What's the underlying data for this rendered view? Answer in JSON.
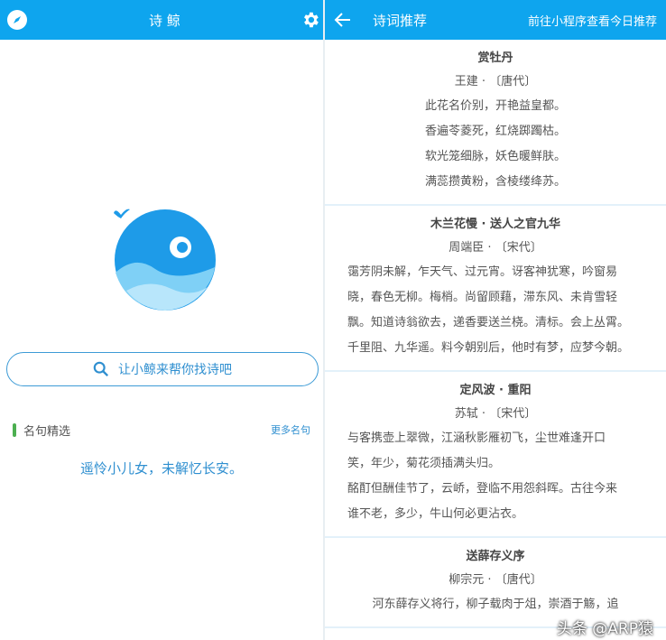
{
  "home": {
    "title": "诗 鲸",
    "search_placeholder": "让小鲸来帮你找诗吧",
    "section_title": "名句精选",
    "more_label": "更多名句",
    "quote": "遥怜小儿女，未解忆长安。"
  },
  "recommend": {
    "title": "诗词推荐",
    "action": "前往小程序查看今日推荐",
    "poems": [
      {
        "title": "赏牡丹",
        "author": "王建 · 〔唐代〕",
        "align": "center",
        "lines": [
          "此花名价别，开艳益皇都。",
          "香遍苓菱死，红烧踯躅枯。",
          "软光笼细脉，妖色暖鲜肤。",
          "满蕊攒黄粉，含棱缕绛苏。"
        ]
      },
      {
        "title": "木兰花慢 · 送人之官九华",
        "author": "周端臣 · 〔宋代〕",
        "align": "left",
        "lines": [
          "霭芳阴未解，乍天气、过元宵。讶客神犹寒，吟窗易",
          "晓，春色无柳。梅梢。尚留顾藉，滞东风、未肯雪轻",
          "飘。知道诗翁欲去，递香要送兰桡。清标。会上丛霄。",
          "千里阻、九华遥。料今朝别后，他时有梦，应梦今朝。"
        ]
      },
      {
        "title": "定风波 · 重阳",
        "author": "苏轼 · 〔宋代〕",
        "align": "left",
        "lines": [
          "与客携壶上翠微，江涵秋影雁初飞，尘世难逢开口",
          "笑，年少，菊花须插满头归。",
          "酩酊但酬佳节了，云峤，登临不用怨斜晖。古往今来",
          "谁不老，多少，牛山何必更沾衣。"
        ]
      },
      {
        "title": "送薛存义序",
        "author": "柳宗元 · 〔唐代〕",
        "align": "center",
        "lines": [
          "河东薛存义将行，柳子载肉于俎，崇酒于觞，追"
        ]
      }
    ]
  },
  "watermark": "头条 @ARP猿",
  "colors": {
    "primary": "#0ea5ee",
    "accent": "#2f8fd0",
    "green": "#4caf50"
  }
}
